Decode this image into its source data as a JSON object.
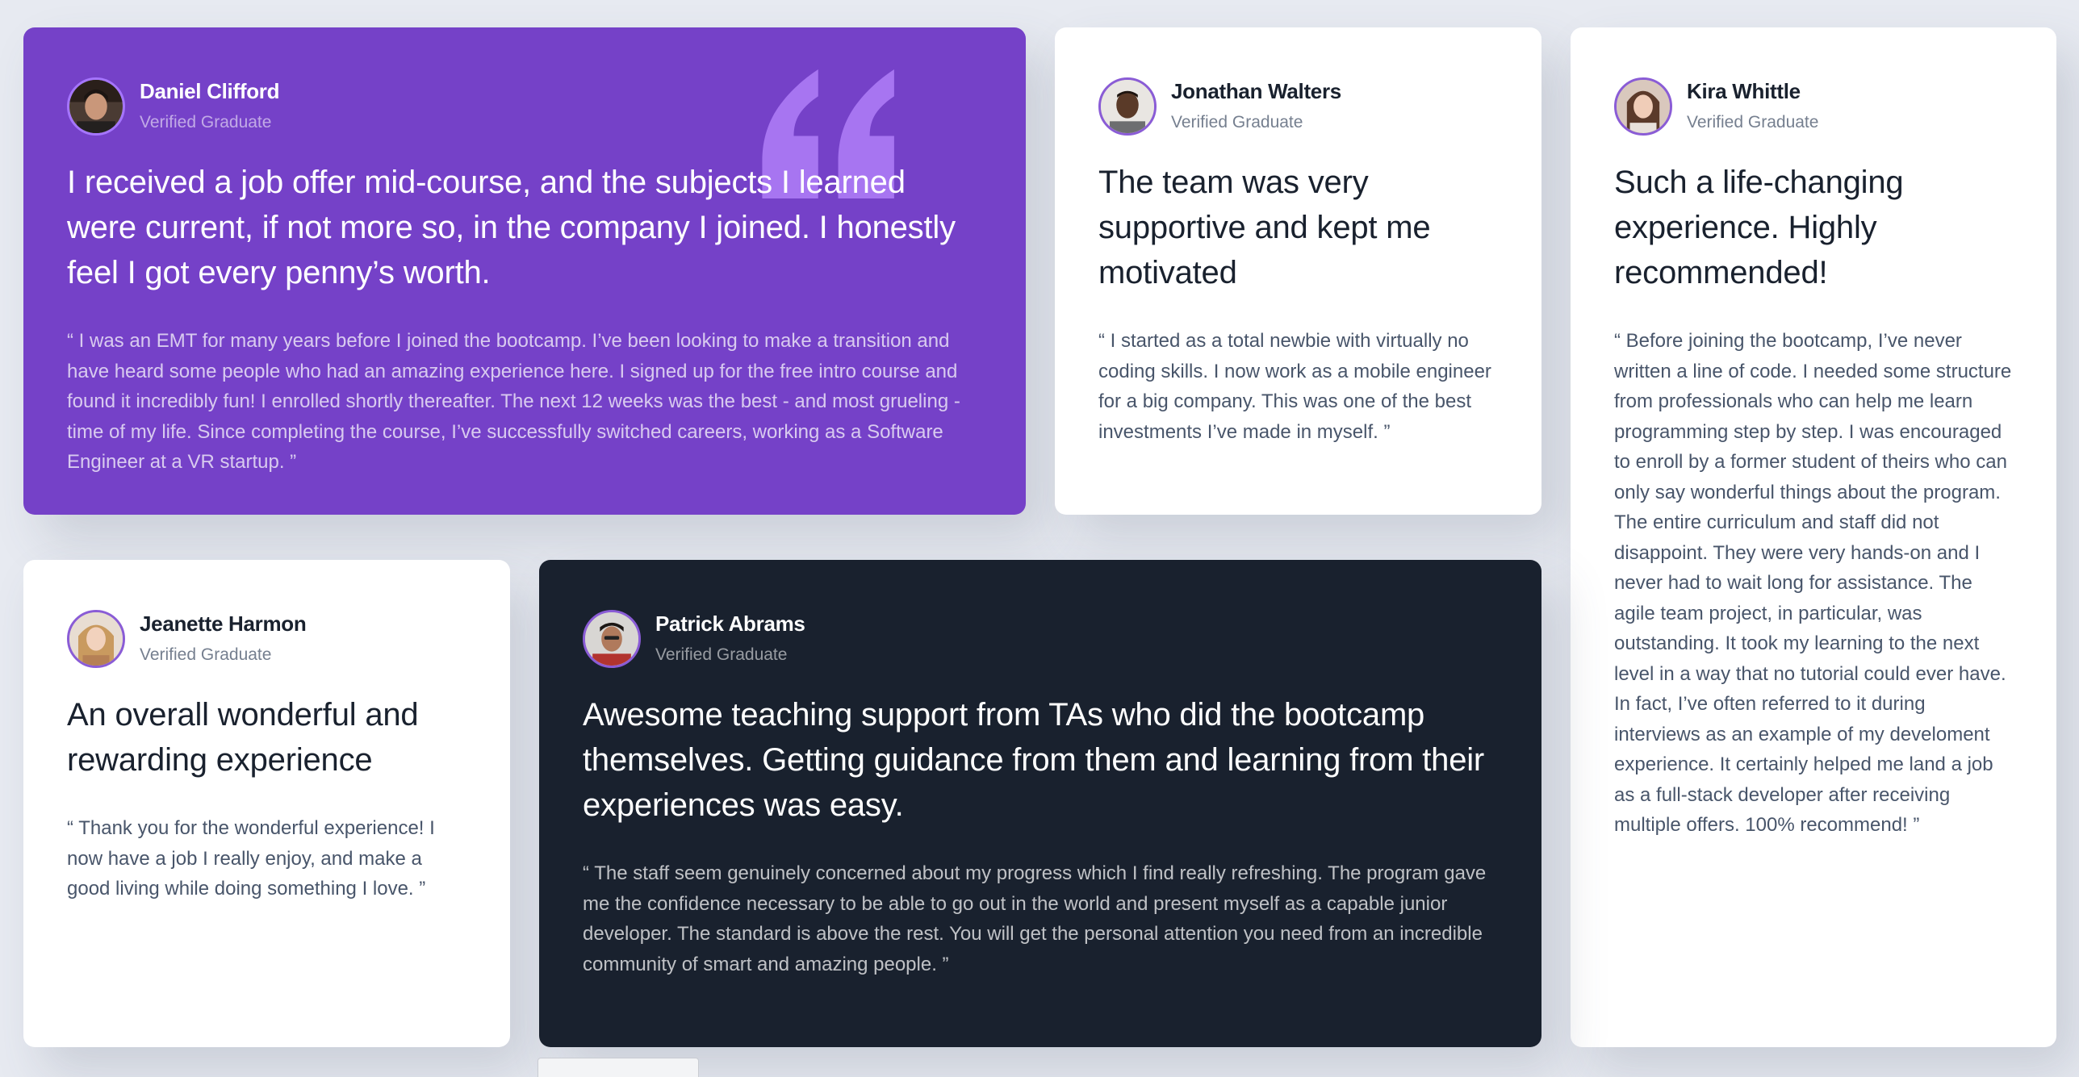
{
  "testimonials": [
    {
      "name": "Daniel Clifford",
      "role": "Verified Graduate",
      "headline": "I received a job offer mid-course, and the subjects I learned were current, if not more so, in the company I joined. I honestly feel I got every penny’s worth.",
      "body": "“ I was an EMT for many years before I joined the bootcamp. I’ve been looking to make a transition and have heard some people who had an amazing experience here. I signed up for the free intro course and found it incredibly fun! I enrolled shortly thereafter. The next 12 weeks was the best - and most grueling - time of my life. Since completing the course, I’ve successfully switched careers, working as a Software Engineer at a VR startup. ”"
    },
    {
      "name": "Jonathan Walters",
      "role": "Verified Graduate",
      "headline": "The team was very supportive and kept me motivated",
      "body": "“ I started as a total newbie with virtually no coding skills. I now work as a mobile engineer for a big company. This was one of the best investments I’ve made in myself. ”"
    },
    {
      "name": "Kira Whittle",
      "role": "Verified Graduate",
      "headline": "Such a life-changing experience. Highly recommended!",
      "body": "“ Before joining the bootcamp, I’ve never written a line of code. I needed some structure from professionals who can help me learn programming step by step. I was encouraged to enroll by a former student of theirs who can only say wonderful things about the program. The entire curriculum and staff did not disappoint. They were very hands-on and I never had to wait long for assistance. The agile team project, in particular, was outstanding. It took my learning to the next level in a way that no tutorial could ever have. In fact, I’ve often referred to it during interviews as an example of my develoment experience. It certainly helped me land a job as a full-stack developer after receiving multiple offers. 100% recommend! ”"
    },
    {
      "name": "Jeanette Harmon",
      "role": "Verified Graduate",
      "headline": "An overall wonderful and rewarding experience",
      "body": "“ Thank you for the wonderful experience! I now have a job I really enjoy, and make a good living while doing something I love. ”"
    },
    {
      "name": "Patrick Abrams",
      "role": "Verified Graduate",
      "headline": "Awesome teaching support from TAs who did the bootcamp themselves. Getting guidance from them and learning from their experiences was easy.",
      "body": "“ The staff seem genuinely concerned about my progress which I find really refreshing. The program gave me the confidence necessary to be able to go out in the world and present myself as a capable junior developer. The standard is above the rest. You will get the personal attention you need from an incredible community of smart and amazing people. ”"
    }
  ],
  "colors": {
    "purple": "#7541c8",
    "dark_blue": "#19212e",
    "light_purple": "#a575ff",
    "background": "#e7eaf1"
  },
  "icons": {
    "quote": "quotation-mark-icon"
  }
}
